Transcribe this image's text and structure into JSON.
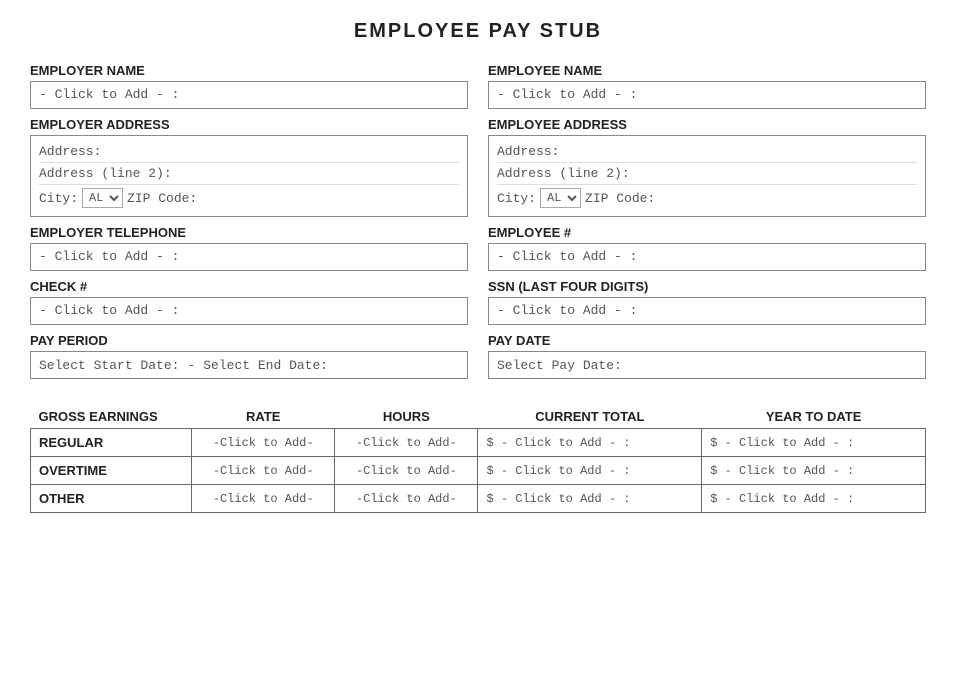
{
  "title": "EMPLOYEE PAY STUB",
  "left": {
    "employer_name_label": "EMPLOYER NAME",
    "employer_name_placeholder": "- Click to Add - :",
    "employer_address_label": "EMPLOYER ADDRESS",
    "address_line1": "Address:",
    "address_line2": "Address (line 2):",
    "address_city": "City:",
    "address_state_default": "AL",
    "address_zip": "ZIP Code:",
    "employer_telephone_label": "EMPLOYER TELEPHONE",
    "employer_telephone_placeholder": "- Click to Add - :",
    "check_label": "CHECK #",
    "check_placeholder": "- Click to Add - :",
    "pay_period_label": "PAY PERIOD",
    "pay_period_start": "Select Start Date:",
    "pay_period_end": "Select End Date:"
  },
  "right": {
    "employee_name_label": "EMPLOYEE NAME",
    "employee_name_placeholder": "- Click to Add - :",
    "employee_address_label": "EMPLOYEE ADDRESS",
    "address_line1": "Address:",
    "address_line2": "Address (line 2):",
    "address_city": "City:",
    "address_state_default": "AL",
    "address_zip": "ZIP Code:",
    "employee_num_label": "EMPLOYEE #",
    "employee_num_placeholder": "- Click to Add - :",
    "ssn_label": "SSN (LAST FOUR DIGITS)",
    "ssn_placeholder": "- Click to Add - :",
    "pay_date_label": "PAY DATE",
    "pay_date_placeholder": "Select Pay Date:"
  },
  "earnings": {
    "headers": {
      "gross": "GROSS EARNINGS",
      "rate": "RATE",
      "hours": "HOURS",
      "current": "CURRENT TOTAL",
      "ytd": "YEAR TO DATE"
    },
    "rows": [
      {
        "label": "REGULAR",
        "rate": "-Click to Add-",
        "hours": "-Click to Add-",
        "current": "$ - Click to Add - :",
        "ytd": "$ - Click to Add - :"
      },
      {
        "label": "OVERTIME",
        "rate": "-Click to Add-",
        "hours": "-Click to Add-",
        "current": "$ - Click to Add - :",
        "ytd": "$ - Click to Add - :"
      },
      {
        "label": "OTHER",
        "rate": "-Click to Add-",
        "hours": "-Click to Add-",
        "current": "$ - Click to Add - :",
        "ytd": "$ - Click to Add - :"
      }
    ]
  }
}
